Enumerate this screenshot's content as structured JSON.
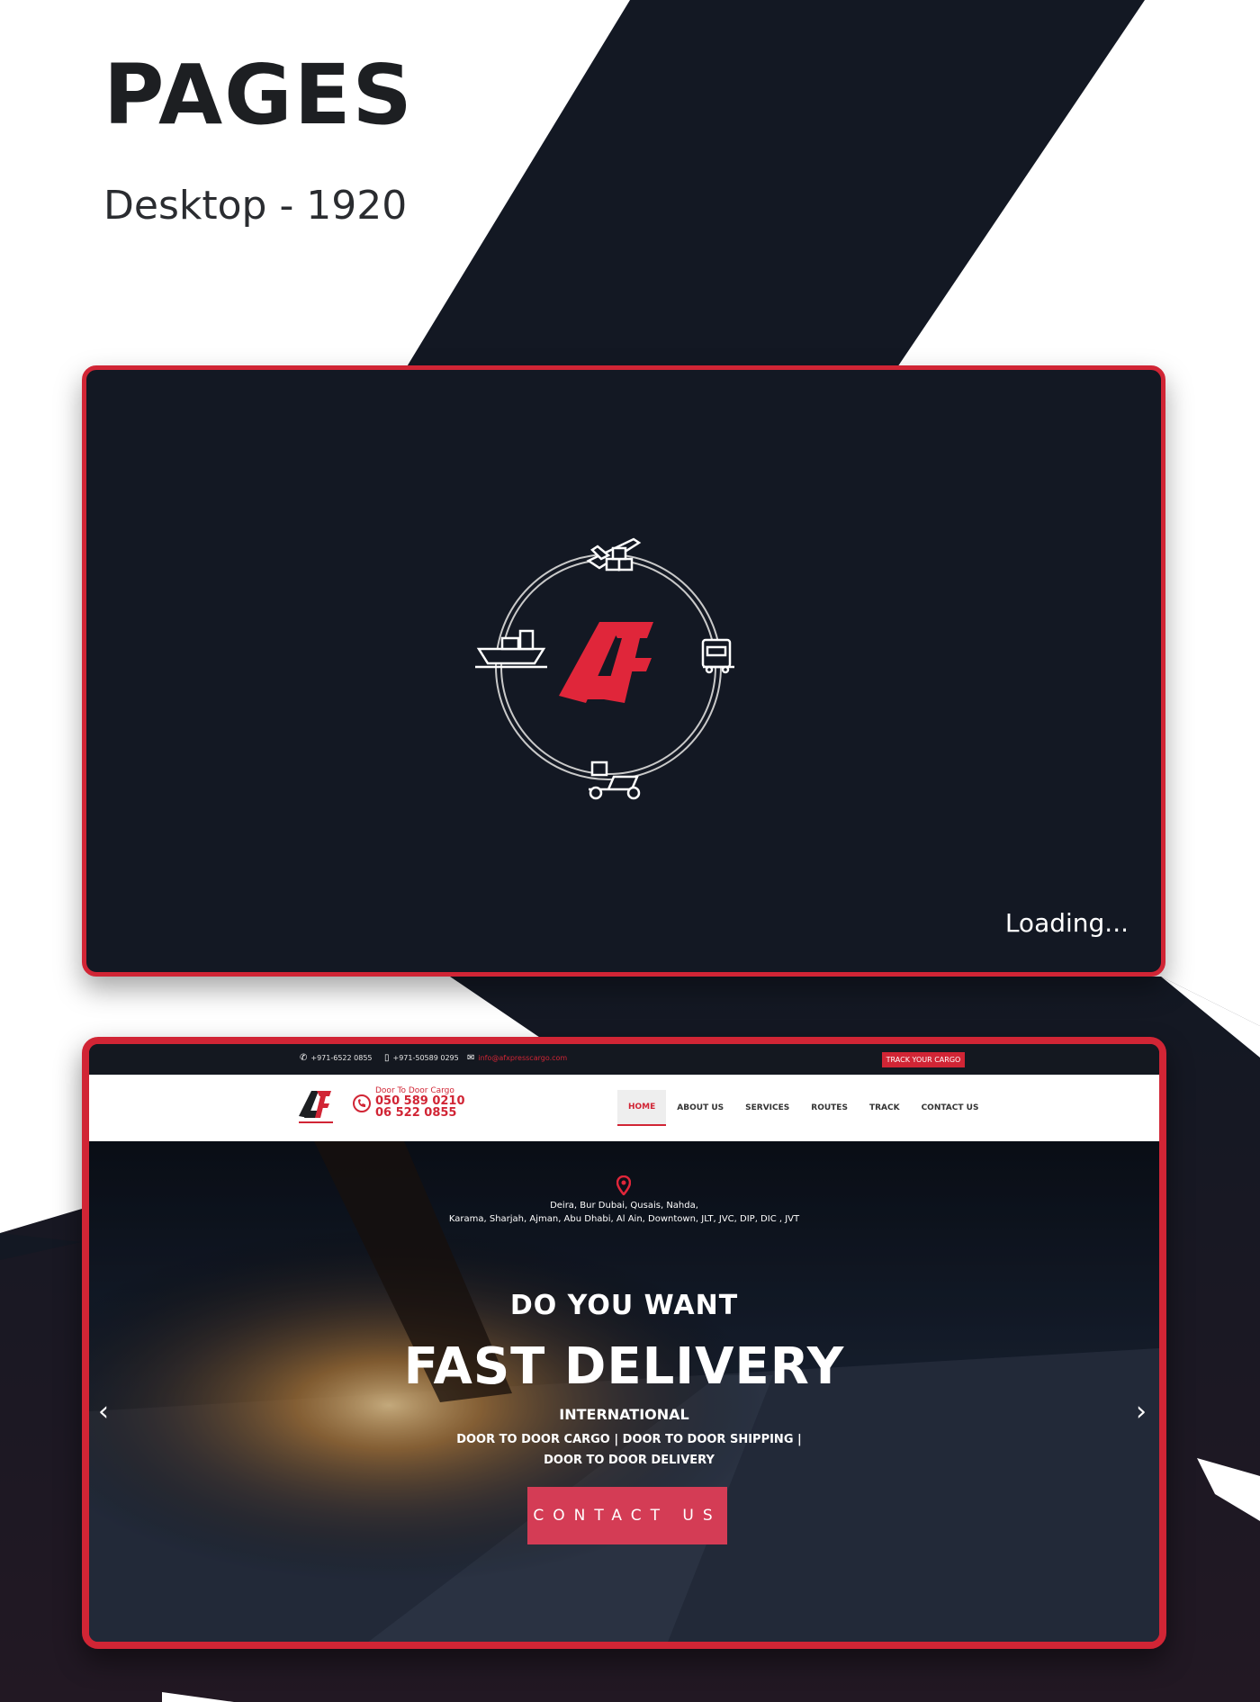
{
  "page": {
    "heading": "PAGES",
    "subheading": "Desktop - 1920"
  },
  "loading_screen": {
    "logo": "AF",
    "icons": [
      "airplane-icon",
      "ship-icon",
      "truck-icon",
      "scooter-icon",
      "boxes-icon"
    ],
    "status_text": "Loading..."
  },
  "home": {
    "topbar": {
      "phone": "+971-6522 0855",
      "mobile": "+971-50589 0295",
      "email": "info@afxpresscargo.com",
      "track_button": "TRACK YOUR CARGO"
    },
    "nav": {
      "tagline": "Door To Door Cargo",
      "phone_1": "050 589 0210",
      "phone_2": "06 522 0855",
      "links": [
        {
          "label": "HOME"
        },
        {
          "label": "ABOUT US"
        },
        {
          "label": "SERVICES"
        },
        {
          "label": "ROUTES"
        },
        {
          "label": "TRACK"
        },
        {
          "label": "CONTACT US"
        }
      ]
    },
    "hero": {
      "areas_line_1": "Deira, Bur Dubai, Qusais, Nahda,",
      "areas_line_2": "Karama, Sharjah, Ajman, Abu Dhabi, Al Ain, Downtown, JLT, JVC, DIP, DIC , JVT",
      "pre_title": "DO YOU WANT",
      "title": "FAST DELIVERY",
      "subtitle": "INTERNATIONAL",
      "description": "DOOR TO DOOR CARGO | DOOR TO DOOR SHIPPING | DOOR TO DOOR DELIVERY",
      "cta": "CONTACT US",
      "prev_arrow": "‹",
      "next_arrow": "›"
    }
  },
  "colors": {
    "brand_red": "#d12535",
    "dark_navy": "#131823",
    "cta_pink": "#d43c55"
  }
}
